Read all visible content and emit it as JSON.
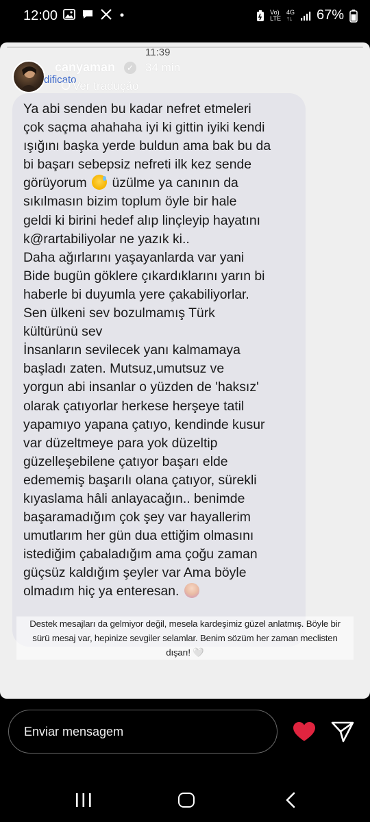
{
  "status_bar": {
    "time": "12:00",
    "network_top": "Vo)",
    "network_bottom": "LTE",
    "net_type": "4G",
    "battery": "67%",
    "icons": [
      "gallery-icon",
      "message-bubble-icon",
      "x-logo-icon",
      "dot-icon",
      "battery-saver-icon",
      "signal-icon",
      "battery-icon"
    ]
  },
  "story": {
    "clock": "11:39",
    "username": "canyaman",
    "posted": "34 min",
    "edited_label": "dificato",
    "translate_label": "Ver tradução",
    "message_lines": [
      "Ya abi senden bu kadar nefret etmeleri",
      "çok saçma ahahaha iyi ki gittin iyiki kendi",
      "ışığını başka yerde buldun ama bak bu da",
      "bi başarı sebepsiz nefreti ilk kez sende",
      "görüyorum",
      "üzülme ya canının da",
      "sıkılmasın bizim toplum öyle bir hale",
      "geldi ki birini hedef alıp linçleyip hayatını",
      "k@rartabiliyolar ne yazık ki..",
      "Daha ağırlarını yaşayanlarda var yani",
      "Bide bugün göklere çıkardıklarını yarın bi",
      "haberle bi duyumla yere çakabiliyorlar.",
      "Sen ülkeni sev bozulmamış Türk",
      "kültürünü sev",
      "İnsanların sevilecek yanı kalmamaya",
      "başladı zaten. Mutsuz,umutsuz ve",
      "yorgun abi insanlar o yüzden de 'haksız'",
      "olarak çatıyorlar herkese herşeye tatil",
      "yapamıyo yapana çatıyo, kendinde kusur",
      "var düzeltmeye para yok düzeltip",
      "güzelleşebilene çatıyor başarı elde",
      "edememiş başarılı olana çatıyor, sürekli",
      "kıyaslama hâli anlayacağın.. benimde",
      "başaramadığım çok şey var hayallerim",
      "umutlarım her gün dua ettiğim olmasını",
      "istediğim çabaladığım ama çoğu zaman",
      "güçsüz kaldığım şeyler var Ama böyle",
      "olmadım hiç ya enteresan."
    ],
    "caption_lines": [
      "Destek mesajları da gelmiyor değil, mesela kardeşimiz güzel anlatmış. Böyle bir",
      "sürü mesaj var, hepinize sevgiler selamlar. Benim sözüm her zaman meclisten",
      "dışarı! 🤍"
    ]
  },
  "reply": {
    "placeholder": "Enviar mensagem"
  },
  "colors": {
    "story_background": "#efefef",
    "bubble": "#e4e4ea",
    "heart": "#e0243f",
    "edited_link": "#3a67c9"
  }
}
